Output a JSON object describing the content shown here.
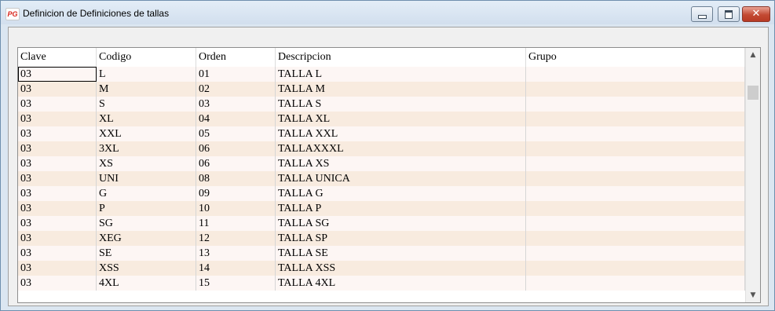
{
  "window": {
    "title": "Definicion de Definiciones de tallas",
    "app_icon_text": "PG"
  },
  "grid": {
    "columns": [
      "Clave",
      "Codigo",
      "Orden",
      "Descripcion",
      "Grupo"
    ],
    "rows": [
      [
        "03",
        "L",
        "01",
        "TALLA L",
        ""
      ],
      [
        "03",
        "M",
        "02",
        "TALLA M",
        ""
      ],
      [
        "03",
        "S",
        "03",
        "TALLA S",
        ""
      ],
      [
        "03",
        "XL",
        "04",
        "TALLA XL",
        ""
      ],
      [
        "03",
        "XXL",
        "05",
        "TALLA XXL",
        ""
      ],
      [
        "03",
        "3XL",
        "06",
        "TALLAXXXL",
        ""
      ],
      [
        "03",
        "XS",
        "06",
        "TALLA XS",
        ""
      ],
      [
        "03",
        "UNI",
        "08",
        "TALLA UNICA",
        ""
      ],
      [
        "03",
        "G",
        "09",
        "TALLA G",
        ""
      ],
      [
        "03",
        "P",
        "10",
        "TALLA P",
        ""
      ],
      [
        "03",
        "SG",
        "11",
        "TALLA SG",
        ""
      ],
      [
        "03",
        "XEG",
        "12",
        "TALLA SP",
        ""
      ],
      [
        "03",
        "SE",
        "13",
        "TALLA SE",
        ""
      ],
      [
        "03",
        "XSS",
        "14",
        "TALLA XSS",
        ""
      ],
      [
        "03",
        "4XL",
        "15",
        "TALLA 4XL",
        ""
      ]
    ],
    "row_colors": [
      "#fdf6f4",
      "#f8ebdf"
    ]
  },
  "scrollbar": {
    "up_glyph": "▲",
    "down_glyph": "▼"
  }
}
